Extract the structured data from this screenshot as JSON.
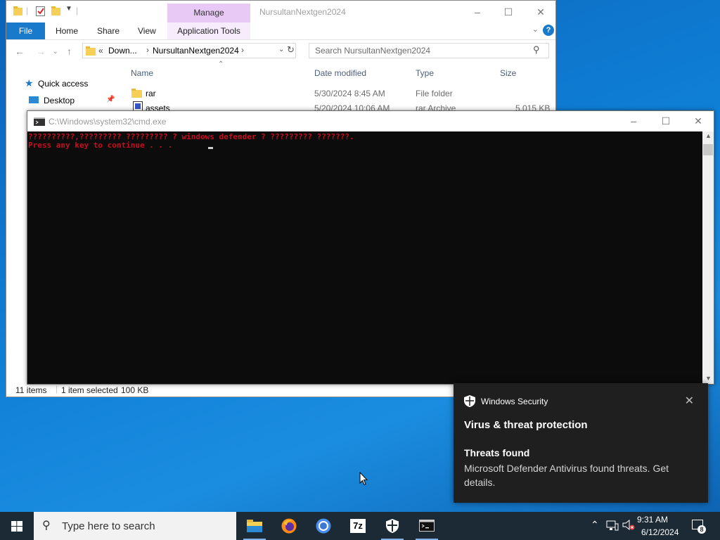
{
  "explorer": {
    "window_title": "NursultanNextgen2024",
    "context_tab": "Manage",
    "ribbon_tabs": [
      "File",
      "Home",
      "Share",
      "View",
      "Application Tools"
    ],
    "breadcrumb": {
      "prefix": "«",
      "items": [
        "Down...",
        "NursultanNextgen2024"
      ]
    },
    "search_placeholder": "Search NursultanNextgen2024",
    "nav": {
      "quick_access": "Quick access",
      "desktop": "Desktop"
    },
    "columns": {
      "name": "Name",
      "date": "Date modified",
      "type": "Type",
      "size": "Size"
    },
    "files": [
      {
        "name": "rar",
        "date": "5/30/2024 8:45 AM",
        "type": "File folder",
        "size": ""
      },
      {
        "name": "assets",
        "date": "5/20/2024 10:06 AM",
        "type": "rar Archive",
        "size": "5,015 KB"
      }
    ],
    "status": {
      "items": "11 items",
      "selected": "1 item selected",
      "size": "100 KB"
    }
  },
  "cmd": {
    "title": "C:\\Windows\\system32\\cmd.exe",
    "lines": [
      "??????????,????????? ????????? ? windows defender ? ????????? ???????.",
      "Press any key to continue . . ."
    ],
    "text_color": "#c50f1f"
  },
  "toast": {
    "app": "Windows Security",
    "heading": "Virus & threat protection",
    "title": "Threats found",
    "message": "Microsoft Defender Antivirus found threats. Get details."
  },
  "taskbar": {
    "search_placeholder": "Type here to search",
    "apps": [
      "file-explorer-icon",
      "firefox-icon",
      "chrome-icon",
      "7zip-icon",
      "windows-security-icon",
      "command-prompt-icon"
    ],
    "seven_zip_label": "7z",
    "time": "9:31 AM",
    "date": "6/12/2024",
    "notification_count": "8"
  }
}
